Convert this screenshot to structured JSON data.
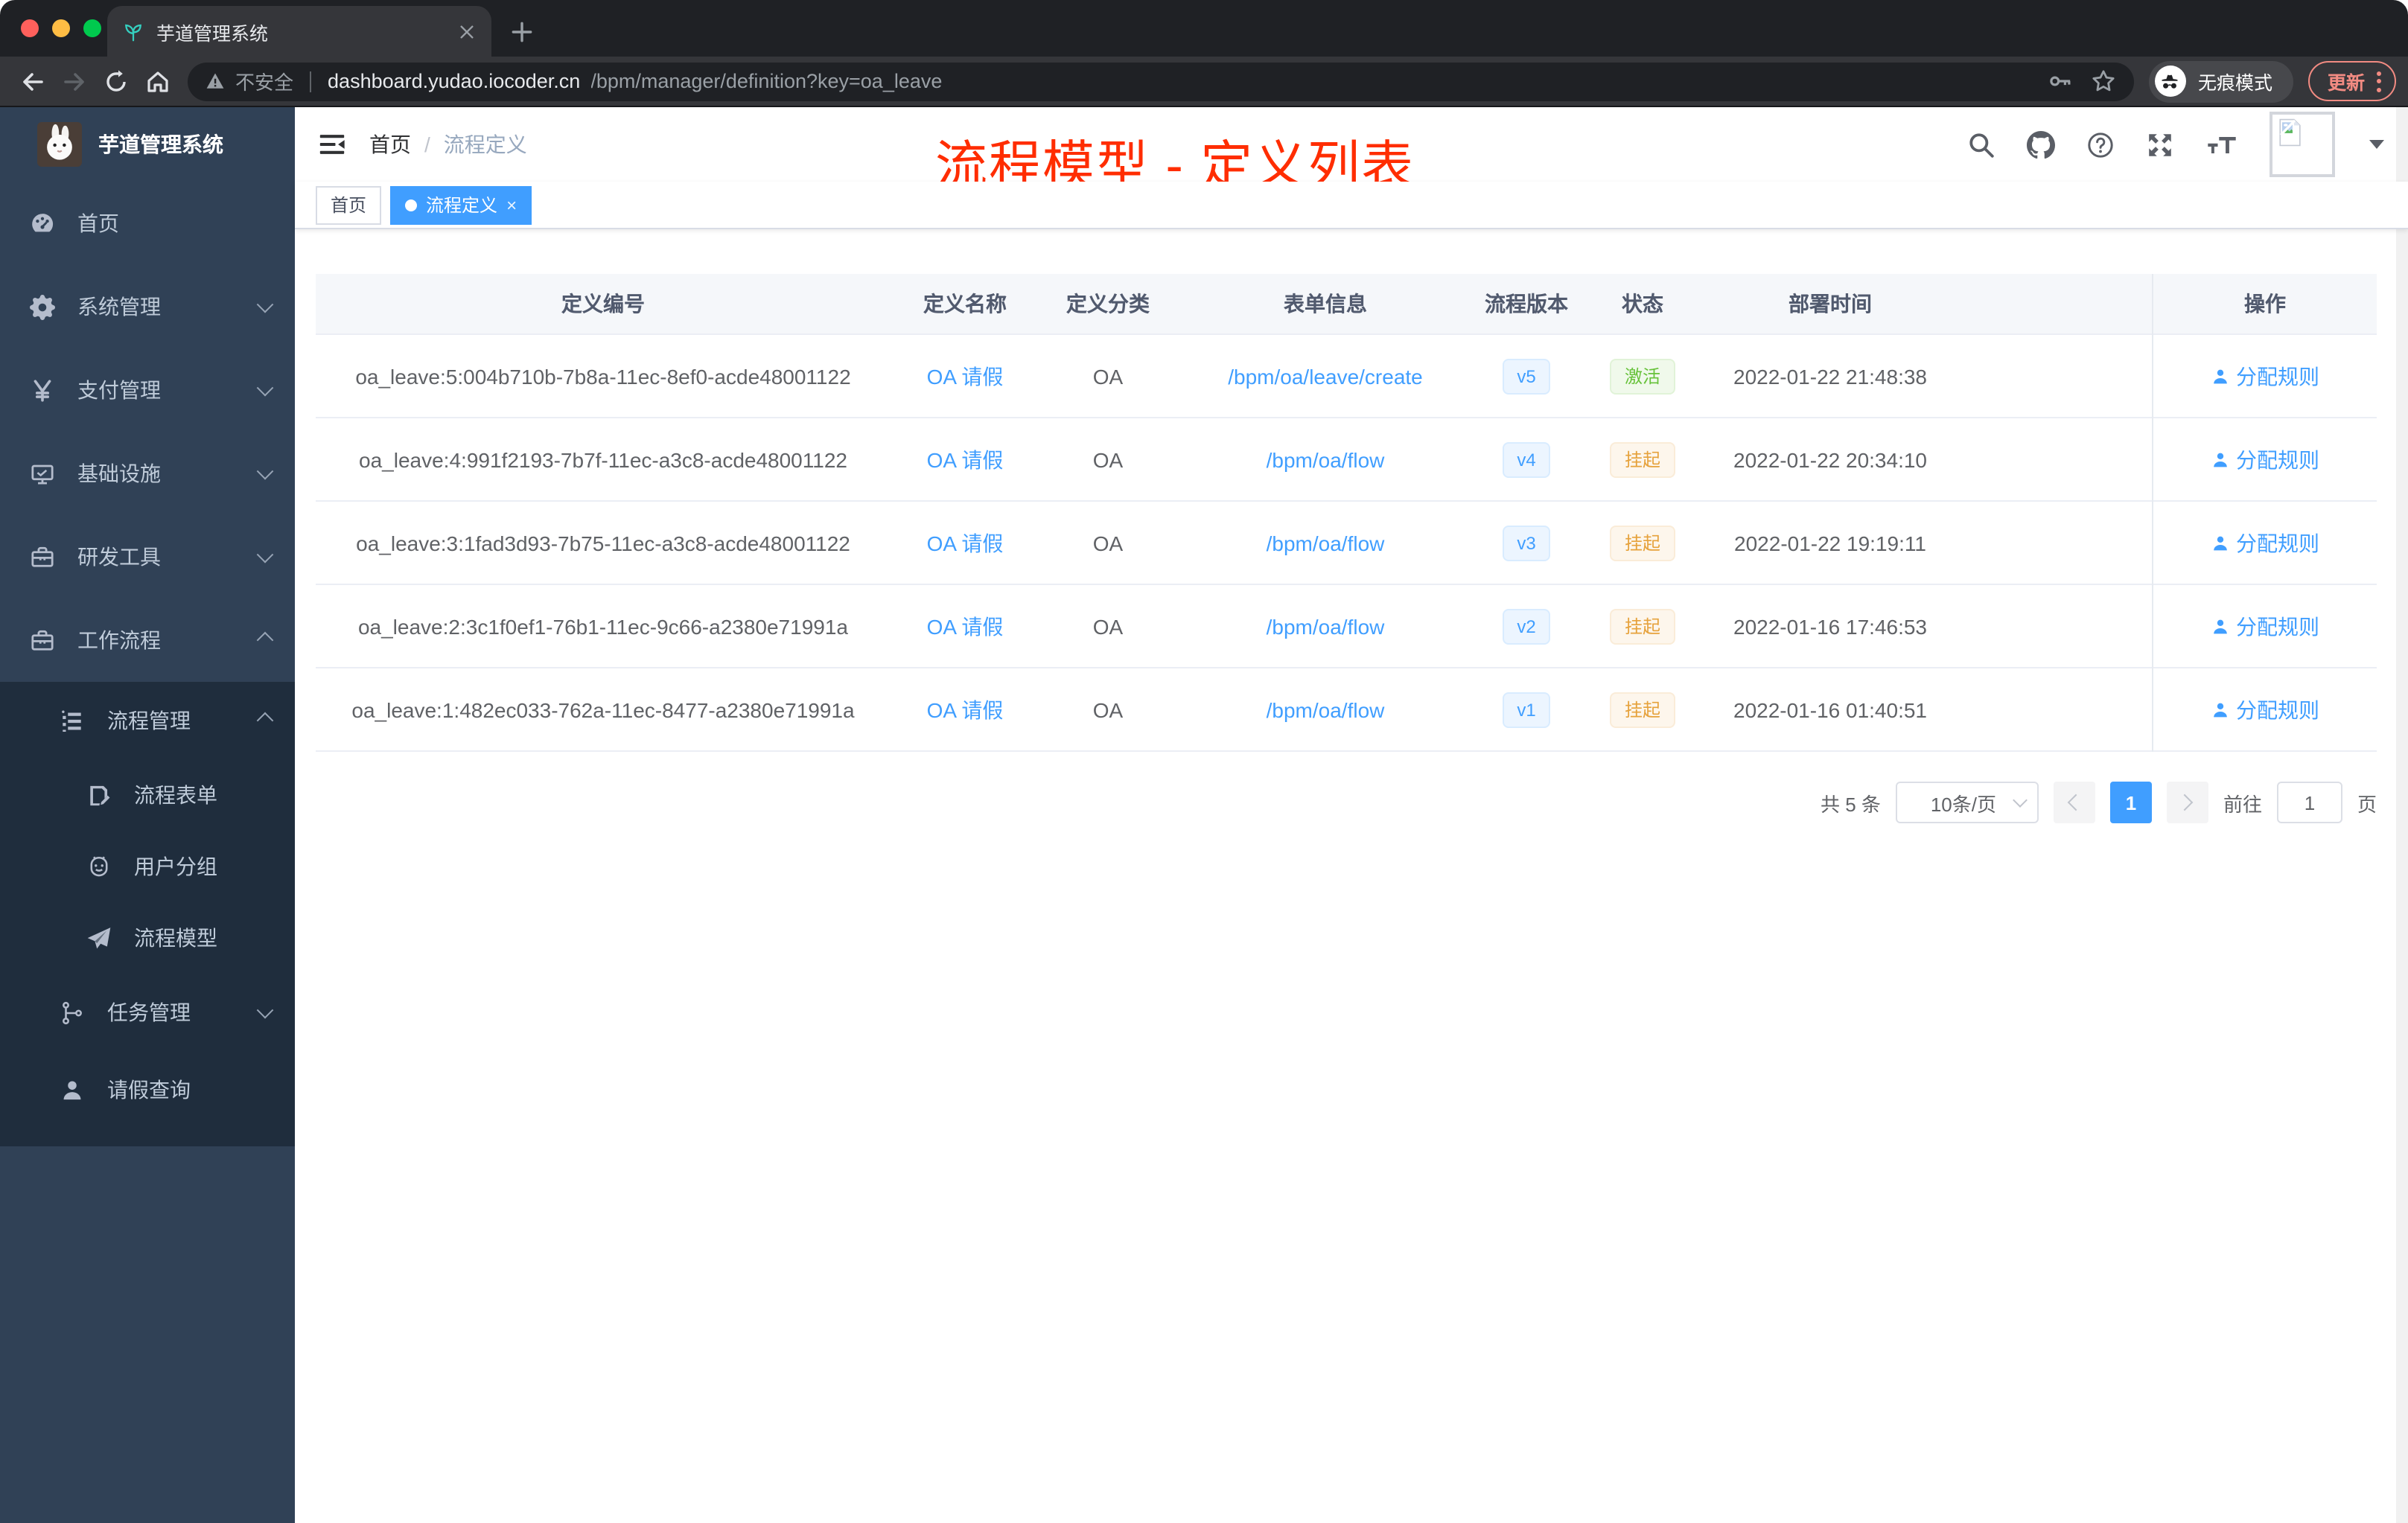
{
  "colors": {
    "accent": "#409eff",
    "annotation_red": "#ff2d00",
    "sidebar_bg": "#304156",
    "submenu_bg": "#1f2d3d",
    "success": "#67c23a",
    "warning": "#e6a23c"
  },
  "browser": {
    "tab_title": "芋道管理系统",
    "security_label": "不安全",
    "url_host": "dashboard.yudao.iocoder.cn",
    "url_path": "/bpm/manager/definition?key=oa_leave",
    "incognito_label": "无痕模式",
    "update_label": "更新"
  },
  "sidebar": {
    "logo_title": "芋道管理系统",
    "menu": [
      {
        "label": "首页",
        "icon": "dashboard-icon",
        "arrow": ""
      },
      {
        "label": "系统管理",
        "icon": "gear-icon",
        "arrow": "down"
      },
      {
        "label": "支付管理",
        "icon": "yen-icon",
        "arrow": "down"
      },
      {
        "label": "基础设施",
        "icon": "monitor-icon",
        "arrow": "down"
      },
      {
        "label": "研发工具",
        "icon": "toolbox-icon",
        "arrow": "down"
      },
      {
        "label": "工作流程",
        "icon": "briefcase-icon",
        "arrow": "up"
      }
    ],
    "submenu": [
      {
        "label": "流程管理",
        "icon": "list-icon",
        "arrow": "up",
        "level": 2
      },
      {
        "label": "流程表单",
        "icon": "form-icon",
        "arrow": "",
        "level": 3
      },
      {
        "label": "用户分组",
        "icon": "robot-icon",
        "arrow": "",
        "level": 3
      },
      {
        "label": "流程模型",
        "icon": "plane-icon",
        "arrow": "",
        "level": 3
      },
      {
        "label": "任务管理",
        "icon": "tree-icon",
        "arrow": "down",
        "level": 2
      },
      {
        "label": "请假查询",
        "icon": "user-icon",
        "arrow": "",
        "level": 2
      }
    ]
  },
  "header": {
    "breadcrumb_home": "首页",
    "breadcrumb_sep": "/",
    "breadcrumb_current": "流程定义",
    "annotation": "流程模型 - 定义列表"
  },
  "tags": [
    {
      "label": "首页",
      "active": false,
      "closable": false
    },
    {
      "label": "流程定义",
      "active": true,
      "closable": true
    }
  ],
  "table": {
    "columns": [
      "定义编号",
      "定义名称",
      "定义分类",
      "表单信息",
      "流程版本",
      "状态",
      "部署时间",
      "操作"
    ],
    "rows": [
      {
        "id": "oa_leave:5:004b710b-7b8a-11ec-8ef0-acde48001122",
        "name": "OA 请假",
        "category": "OA",
        "form": "/bpm/oa/leave/create",
        "version": "v5",
        "status": "激活",
        "status_type": "success",
        "deploy_time": "2022-01-22 21:48:38",
        "action": "分配规则"
      },
      {
        "id": "oa_leave:4:991f2193-7b7f-11ec-a3c8-acde48001122",
        "name": "OA 请假",
        "category": "OA",
        "form": "/bpm/oa/flow",
        "version": "v4",
        "status": "挂起",
        "status_type": "warning",
        "deploy_time": "2022-01-22 20:34:10",
        "action": "分配规则"
      },
      {
        "id": "oa_leave:3:1fad3d93-7b75-11ec-a3c8-acde48001122",
        "name": "OA 请假",
        "category": "OA",
        "form": "/bpm/oa/flow",
        "version": "v3",
        "status": "挂起",
        "status_type": "warning",
        "deploy_time": "2022-01-22 19:19:11",
        "action": "分配规则"
      },
      {
        "id": "oa_leave:2:3c1f0ef1-76b1-11ec-9c66-a2380e71991a",
        "name": "OA 请假",
        "category": "OA",
        "form": "/bpm/oa/flow",
        "version": "v2",
        "status": "挂起",
        "status_type": "warning",
        "deploy_time": "2022-01-16 17:46:53",
        "action": "分配规则"
      },
      {
        "id": "oa_leave:1:482ec033-762a-11ec-8477-a2380e71991a",
        "name": "OA 请假",
        "category": "OA",
        "form": "/bpm/oa/flow",
        "version": "v1",
        "status": "挂起",
        "status_type": "warning",
        "deploy_time": "2022-01-16 01:40:51",
        "action": "分配规则"
      }
    ]
  },
  "pagination": {
    "total_label": "共 5 条",
    "page_size_label": "10条/页",
    "current_page": "1",
    "goto_label": "前往",
    "goto_value": "1",
    "page_unit": "页"
  }
}
